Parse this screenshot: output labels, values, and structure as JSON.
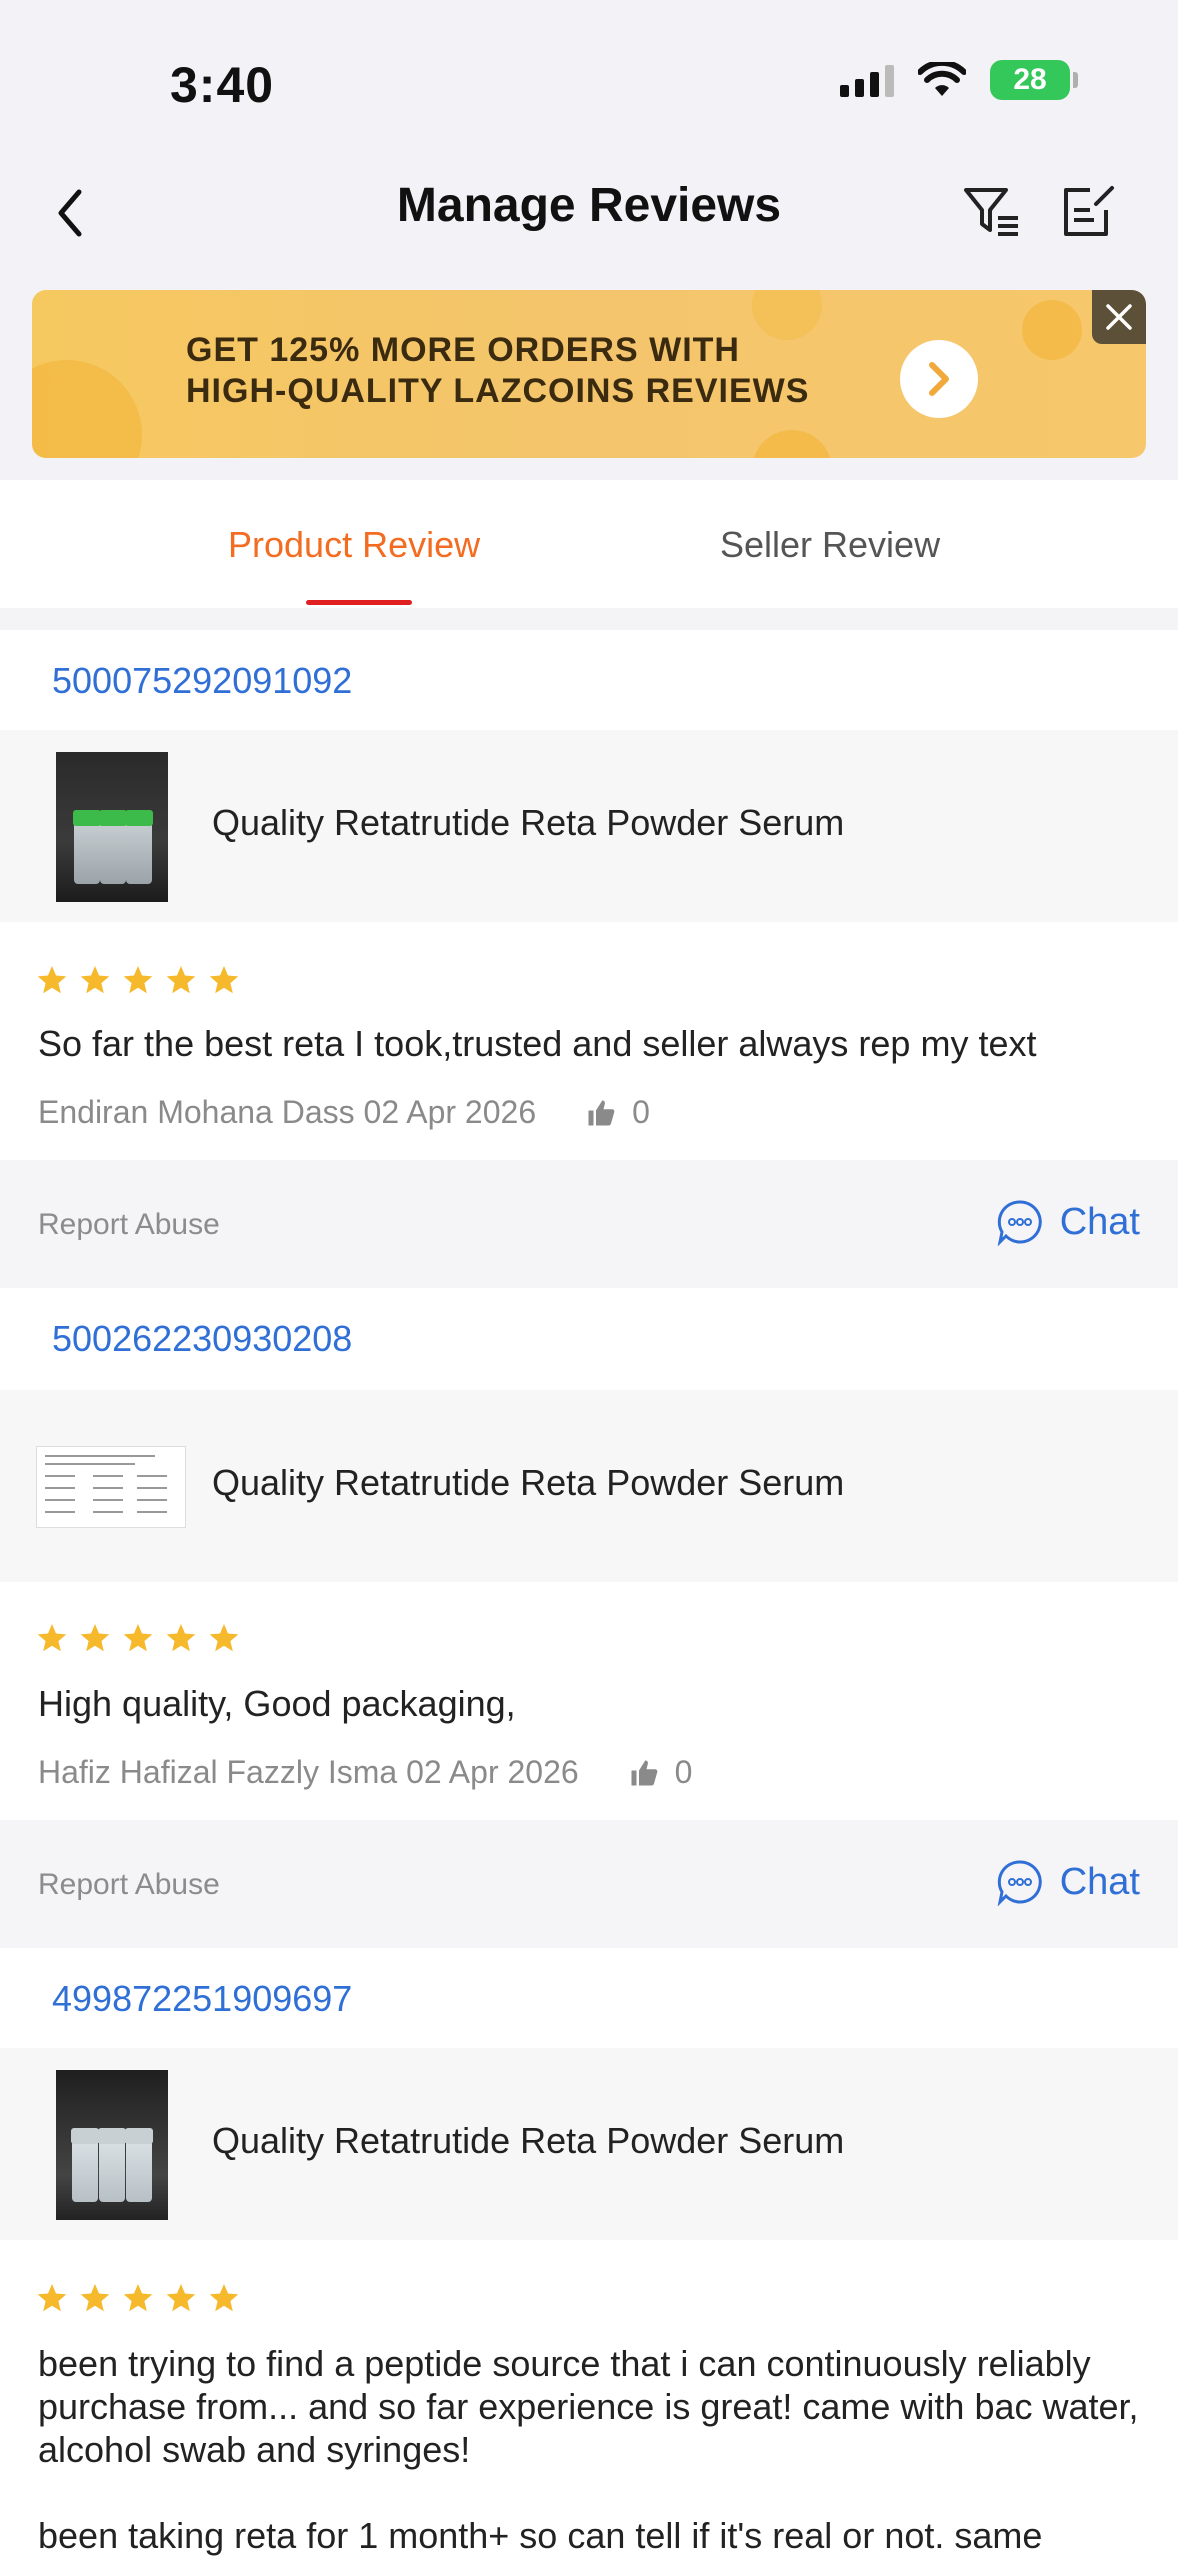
{
  "status": {
    "time": "3:40",
    "battery": "28"
  },
  "nav": {
    "title": "Manage Reviews"
  },
  "banner": {
    "line1": "GET 125% MORE ORDERS WITH",
    "line2": "HIGH-QUALITY LAZCOINS REVIEWS"
  },
  "tabs": [
    {
      "label": "Product Review",
      "active": true
    },
    {
      "label": "Seller Review",
      "active": false
    }
  ],
  "reviews": [
    {
      "order_id": "500075292091092",
      "product": "Quality Retatrutide Reta Powder Serum",
      "rating": 5,
      "text": "So far the best reta I took,trusted and seller always rep my text",
      "reviewer": "Endiran Mohana Dass 02 Apr 2026",
      "likes": "0",
      "report": "Report Abuse",
      "chat": "Chat"
    },
    {
      "order_id": "500262230930208",
      "product": "Quality Retatrutide Reta Powder Serum",
      "rating": 5,
      "text": "High quality, Good packaging,",
      "reviewer": "Hafiz Hafizal Fazzly Isma 02 Apr 2026",
      "likes": "0",
      "report": "Report Abuse",
      "chat": "Chat"
    },
    {
      "order_id": "499872251909697",
      "product": "Quality Retatrutide Reta Powder Serum",
      "rating": 5,
      "text": "been trying to find a peptide source that i can continuously reliably purchase from... and so far experience is great! came with bac water, alcohol swab and syringes!",
      "text2": "been taking reta for 1 month+ so can tell if it's real or not. same"
    }
  ],
  "colors": {
    "accent": "#f36c21",
    "link": "#2f6fd6",
    "star": "#f6b92b",
    "underline": "#e02020"
  }
}
